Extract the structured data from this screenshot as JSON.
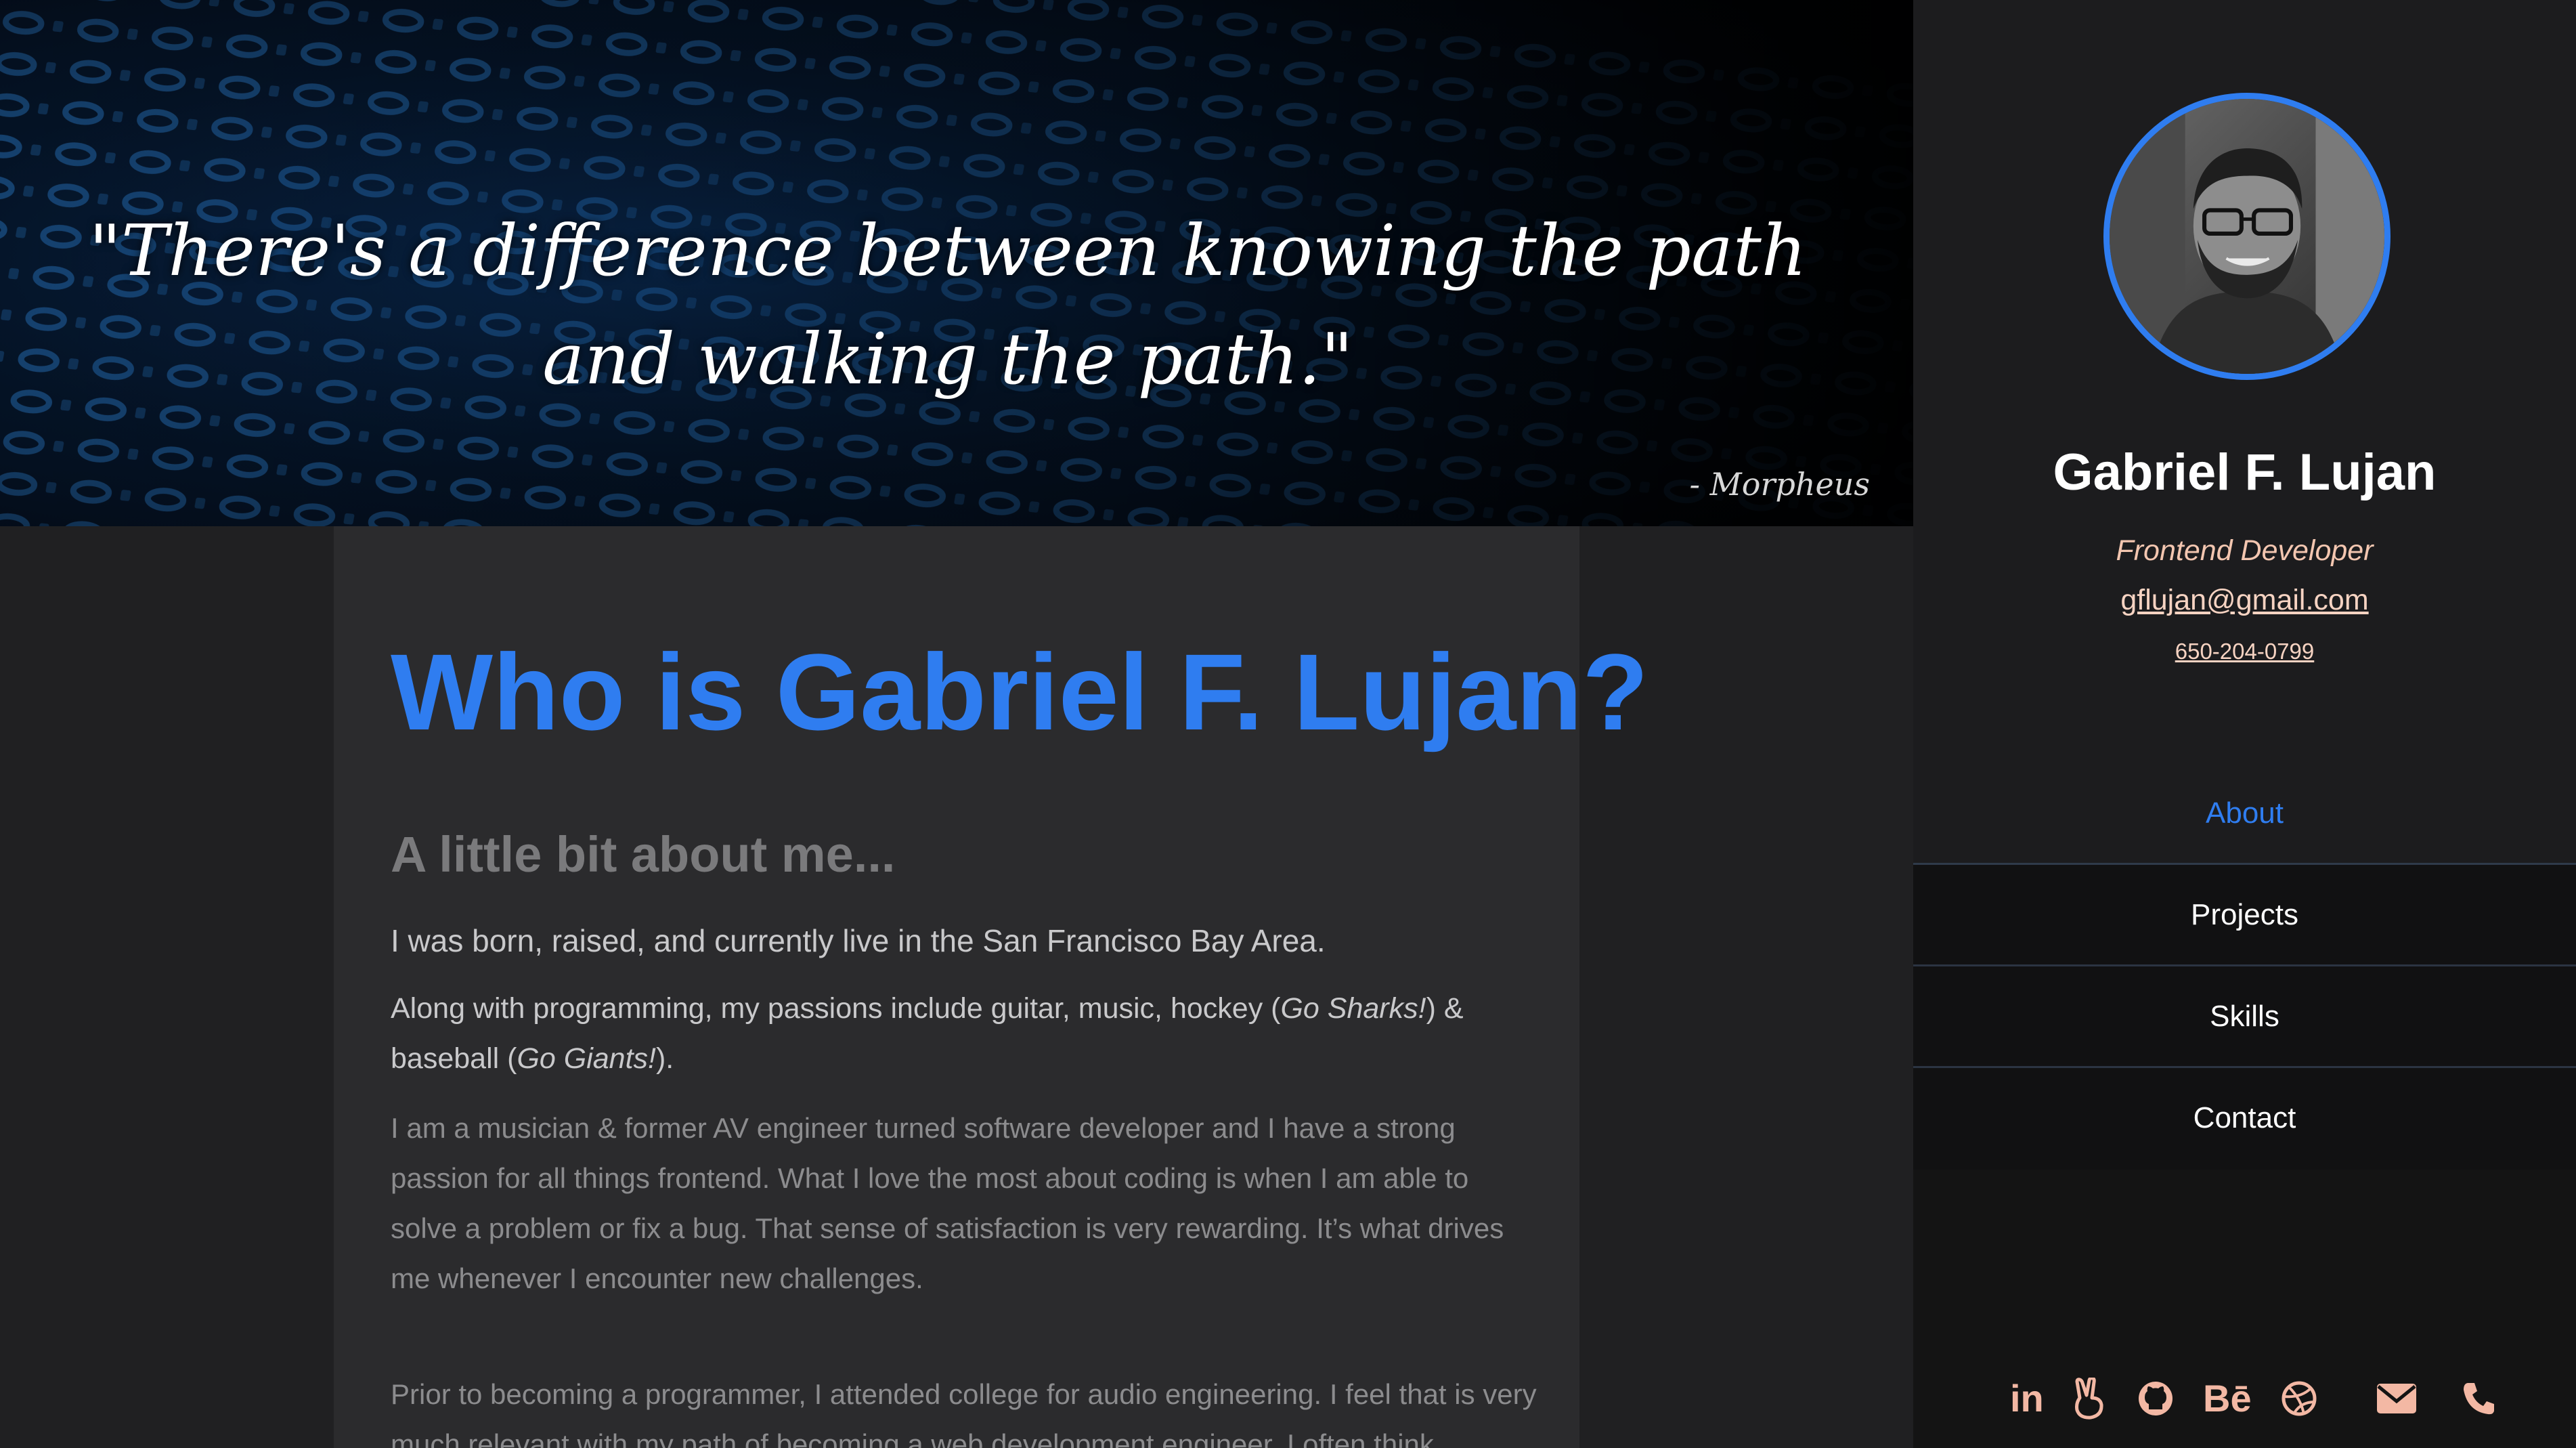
{
  "hero": {
    "quote": "\"There's a difference between knowing the path and walking the path.\"",
    "author": "- Morpheus"
  },
  "main": {
    "title": "Who is Gabriel F. Lujan?",
    "subtitle": "A little bit about me...",
    "para1": "I was born, raised, and currently live in the San Francisco Bay Area.",
    "para2_before": "Along with programming, my passions include guitar, music, hockey (",
    "para2_em1": "Go Sharks!",
    "para2_middle": ") & baseball (",
    "para2_em2": "Go Giants!",
    "para2_after": ").",
    "para3": "I am a musician & former AV engineer turned software developer and I have a strong passion for all things frontend. What I love the most about coding is when I am able to solve a problem or fix a bug. That sense of satisfaction is very rewarding. It’s what drives me whenever I encounter new challenges.",
    "para4": "Prior to becoming a programmer, I attended college for audio engineering. I feel that is very much relevant with my path of becoming a web development engineer. I often think"
  },
  "sidebar": {
    "name": "Gabriel F. Lujan",
    "role": "Frontend Developer",
    "email": "gflujan@gmail.com",
    "phone": "650-204-0799",
    "nav": [
      {
        "label": "About",
        "active": true
      },
      {
        "label": "Projects",
        "active": false
      },
      {
        "label": "Skills",
        "active": false
      },
      {
        "label": "Contact",
        "active": false
      }
    ],
    "social": {
      "linkedin_text": "in",
      "behance_text": "Bē",
      "icons": [
        "linkedin-icon",
        "angellist-icon",
        "github-icon",
        "behance-icon",
        "dribbble-icon",
        "email-icon",
        "phone-icon"
      ]
    }
  },
  "colors": {
    "accent": "#2f7df0",
    "icon": "#f3b8a4",
    "link": "#f6d3c2"
  }
}
